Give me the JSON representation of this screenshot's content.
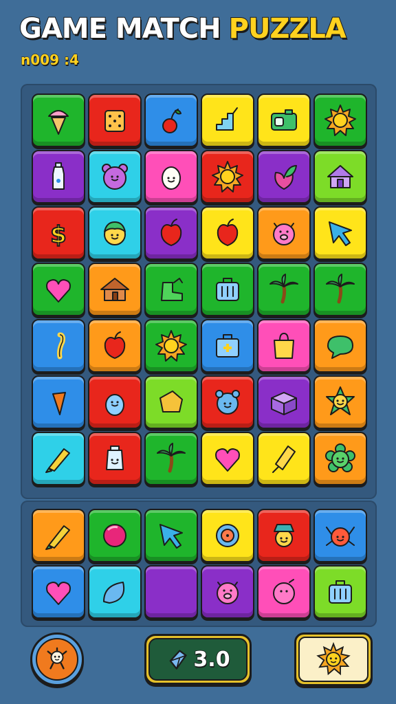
{
  "title": {
    "word1": "GAME MATCH",
    "word2": "PUZZLA"
  },
  "subtitle": "n009 :4",
  "board": {
    "rows": [
      [
        {
          "color": "#1fb52c",
          "icon": "ice-cream-icon"
        },
        {
          "color": "#e8261c",
          "icon": "dice-icon"
        },
        {
          "color": "#2f8ee8",
          "icon": "cherry-icon"
        },
        {
          "color": "#ffe41a",
          "icon": "stairs-icon"
        },
        {
          "color": "#ffe41a",
          "icon": "camera-icon"
        },
        {
          "color": "#1fb52c",
          "icon": "sun-icon"
        }
      ],
      [
        {
          "color": "#8a2fc8",
          "icon": "bottle-icon"
        },
        {
          "color": "#2fd0e8",
          "icon": "bear-face-icon"
        },
        {
          "color": "#ff4fb8",
          "icon": "egg-face-icon"
        },
        {
          "color": "#e8261c",
          "icon": "sun-icon"
        },
        {
          "color": "#8a2fc8",
          "icon": "leaf-fruit-icon"
        },
        {
          "color": "#7ddc28",
          "icon": "house-icon"
        }
      ],
      [
        {
          "color": "#e8261c",
          "icon": "dollar-icon"
        },
        {
          "color": "#2fd0e8",
          "icon": "boy-face-icon"
        },
        {
          "color": "#8a2fc8",
          "icon": "apple-icon"
        },
        {
          "color": "#ffe41a",
          "icon": "apple-icon"
        },
        {
          "color": "#ff9a1a",
          "icon": "pig-face-icon"
        },
        {
          "color": "#ffe41a",
          "icon": "arrow-cursor-icon"
        }
      ],
      [
        {
          "color": "#1fb52c",
          "icon": "heart-icon"
        },
        {
          "color": "#ff9a1a",
          "icon": "cabin-icon"
        },
        {
          "color": "#1fb52c",
          "icon": "boot-icon"
        },
        {
          "color": "#1fb52c",
          "icon": "suitcase-icon"
        },
        {
          "color": "#1fb52c",
          "icon": "palm-tree-icon"
        },
        {
          "color": "#1fb52c",
          "icon": "palm-tree-icon"
        }
      ],
      [
        {
          "color": "#2f8ee8",
          "icon": "hook-icon"
        },
        {
          "color": "#ff9a1a",
          "icon": "apple-icon"
        },
        {
          "color": "#1fb52c",
          "icon": "sun-icon"
        },
        {
          "color": "#2f8ee8",
          "icon": "first-aid-kit-icon"
        },
        {
          "color": "#ff4fb8",
          "icon": "shopping-bag-icon"
        },
        {
          "color": "#ff9a1a",
          "icon": "speech-bubble-icon"
        }
      ],
      [
        {
          "color": "#2f8ee8",
          "icon": "carrot-icon"
        },
        {
          "color": "#e8261c",
          "icon": "penguin-icon"
        },
        {
          "color": "#7ddc28",
          "icon": "cheese-icon"
        },
        {
          "color": "#e8261c",
          "icon": "monster-face-icon"
        },
        {
          "color": "#8a2fc8",
          "icon": "box-icon"
        },
        {
          "color": "#ff9a1a",
          "icon": "star-face-icon"
        }
      ],
      [
        {
          "color": "#2fd0e8",
          "icon": "crayon-icon"
        },
        {
          "color": "#e8261c",
          "icon": "jar-face-icon"
        },
        {
          "color": "#1fb52c",
          "icon": "palm-tree-icon"
        },
        {
          "color": "#ffe41a",
          "icon": "heart-icon"
        },
        {
          "color": "#ffe41a",
          "icon": "ice-pop-icon"
        },
        {
          "color": "#ff9a1a",
          "icon": "flower-face-icon"
        }
      ]
    ]
  },
  "tray": {
    "rows": [
      [
        {
          "color": "#ff9a1a",
          "icon": "crayon-icon"
        },
        {
          "color": "#1fb52c",
          "icon": "ball-icon"
        },
        {
          "color": "#1fb52c",
          "icon": "arrow-cursor-icon"
        },
        {
          "color": "#ffe41a",
          "icon": "clock-icon"
        },
        {
          "color": "#e8261c",
          "icon": "hat-man-icon"
        },
        {
          "color": "#2f8ee8",
          "icon": "crab-icon"
        }
      ],
      [
        {
          "color": "#2f8ee8",
          "icon": "heart-icon"
        },
        {
          "color": "#2fd0e8",
          "icon": "leaf-drop-icon"
        },
        {
          "color": "#8a2fc8",
          "icon": "empty-icon"
        },
        {
          "color": "#8a2fc8",
          "icon": "pig-face-icon"
        },
        {
          "color": "#ff4fb8",
          "icon": "bird-icon"
        },
        {
          "color": "#7ddc28",
          "icon": "suitcase-icon"
        }
      ]
    ]
  },
  "controls": {
    "left_icon": "doll-icon",
    "score_icon": "gem-icon",
    "score_value": "3.0",
    "right_icon": "sun-icon"
  }
}
